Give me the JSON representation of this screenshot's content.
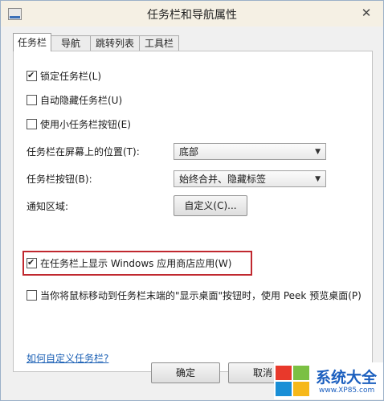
{
  "window": {
    "title": "任务栏和导航属性",
    "close_glyph": "✕"
  },
  "tabs": [
    {
      "label": "任务栏"
    },
    {
      "label": "导航"
    },
    {
      "label": "跳转列表"
    },
    {
      "label": "工具栏"
    }
  ],
  "options": {
    "lock_taskbar": {
      "label": "锁定任务栏(L)",
      "checked": true
    },
    "auto_hide": {
      "label": "自动隐藏任务栏(U)",
      "checked": false
    },
    "small_buttons": {
      "label": "使用小任务栏按钮(E)",
      "checked": false
    },
    "show_store_apps": {
      "label": "在任务栏上显示 Windows 应用商店应用(W)",
      "checked": true
    },
    "peek": {
      "label": "当你将鼠标移动到任务栏末端的\"显示桌面\"按钮时，使用 Peek 预览桌面(P)",
      "checked": false
    }
  },
  "position": {
    "label": "任务栏在屏幕上的位置(T):",
    "value": "底部"
  },
  "buttons_mode": {
    "label": "任务栏按钮(B):",
    "value": "始终合并、隐藏标签"
  },
  "notification": {
    "label": "通知区域:",
    "button": "自定义(C)..."
  },
  "help_link": "如何自定义任务栏?",
  "footer": {
    "ok": "确定",
    "cancel": "取消"
  },
  "watermark": {
    "brand": "系统大全",
    "site": "www.XP85.com",
    "colors": [
      "#e8392b",
      "#7bc043",
      "#1a8fd6",
      "#f6b81a"
    ]
  }
}
